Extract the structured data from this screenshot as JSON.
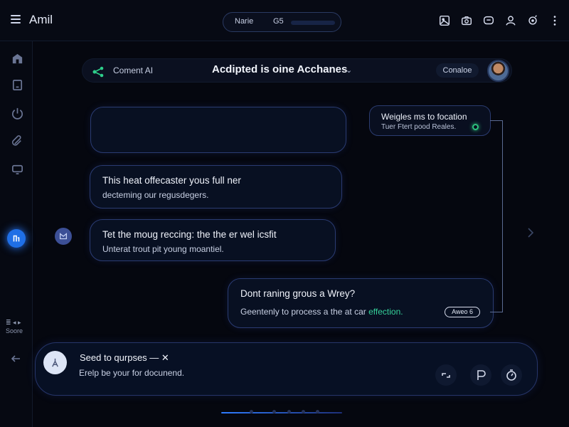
{
  "app": {
    "title": "Amil",
    "search_label": "Narie",
    "search_value": "G5"
  },
  "top_icons": [
    {
      "name": "gallery-icon"
    },
    {
      "name": "camera-icon"
    },
    {
      "name": "chat-icon"
    },
    {
      "name": "user-icon"
    },
    {
      "name": "settings-icon"
    },
    {
      "name": "more-icon"
    }
  ],
  "sidebar": {
    "items": [
      {
        "name": "sidebar-item-home"
      },
      {
        "name": "sidebar-item-files"
      },
      {
        "name": "sidebar-item-power"
      },
      {
        "name": "sidebar-item-attachments"
      },
      {
        "name": "sidebar-item-devices"
      }
    ],
    "small_label_1": "≣ ◂ ▸",
    "small_label_2": "Soore"
  },
  "chat_header": {
    "agent_name": "Coment AI",
    "conversation_title": "Acdipted is oine Acchanes",
    "caret": "⌄",
    "console_button": "Conaloe"
  },
  "messages": {
    "empty": {
      "line1": "",
      "line2": ""
    },
    "m1": {
      "line1": "This heat offecaster yous full ner",
      "line2": "decteming our regusdegers."
    },
    "m2": {
      "line1": "Tet the moug reccing: the the er wel icsfit",
      "line2": "Unterat trout pit young moantiel."
    },
    "m3": {
      "line1": "Dont raning grous a Wrey?",
      "line2_prefix": "Geentenly to process a the at car ",
      "line2_highlight": "effection.",
      "tag": "Aweo 6"
    },
    "side_note": {
      "line1": "Weigles ms to focation",
      "line2": "Tuer Ftert pood Reales."
    }
  },
  "composer": {
    "title": "Seed to qurpses — ✕",
    "placeholder": "Erelp be your for docunend."
  },
  "colors": {
    "accent": "#2a7bff",
    "highlight": "#35d19a",
    "status": "#2dc47e"
  }
}
